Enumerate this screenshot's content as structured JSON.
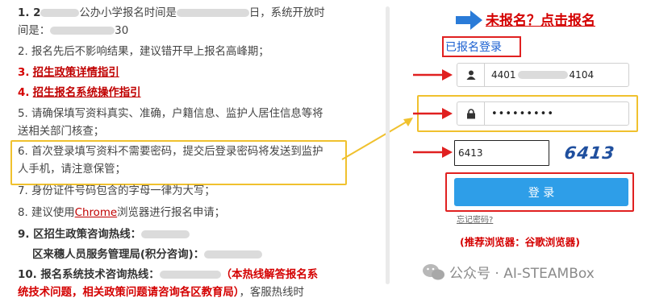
{
  "notice": {
    "l1a": "1. 2",
    "l1b": "公办小学报名时间是",
    "l1c": "日，系统开放时",
    "l1d": "间是：",
    "l1e": "30",
    "l2": "2. 报名先后不影响结果，建议错开早上报名高峰期；",
    "l3n": "3.",
    "l3": "招生政策详情指引",
    "l4n": "4.",
    "l4": "招生报名系统操作指引",
    "l5a": "5. 请确保填写资料真实、准确，户籍信息、监护人居住信息等将",
    "l5b": "送相关部门核查；",
    "l6a": "6. 首次登录填写资料不需要密码，提交后登录密码将发送到监护",
    "l6b": "人手机，请注意保管；",
    "l7": "7. 身份证件号码包含的字母一律为大写；",
    "l8a": "8. 建议使用",
    "l8b": "Chrome",
    "l8c": "浏览器进行报名申请；",
    "l9": "9. 区招生政策咨询热线：",
    "l9b": "区来穗人员服务管理局(积分咨询)：",
    "l10a": "10. 报名系统技术咨询热线：",
    "l10b": "（本热线解答报名系",
    "l10c": "统技术问题，相关政策问题请咨询各区教育局）",
    "l10d": "，客服热线时"
  },
  "login": {
    "title": "未报名？点击报名",
    "registered_login": "已报名登录",
    "id_prefix": "4401",
    "id_suffix": "4104",
    "password_mask": "•••••••••",
    "captcha_value": "6413",
    "captcha_image_text": "6413",
    "login_button": "登 录",
    "forgot": "忘记密码?",
    "browser_tip": "(推荐浏览器：谷歌浏览器)"
  },
  "watermark": "公众号 · AI-STEAMBox",
  "colors": {
    "red": "#d40000",
    "blue_button": "#2e9ee8",
    "yellow": "#f0c12e",
    "link_blue": "#1a5fd1"
  },
  "icons": [
    "user-icon",
    "lock-icon",
    "blue-arrow-icon",
    "red-arrow-icon",
    "wechat-icon"
  ]
}
